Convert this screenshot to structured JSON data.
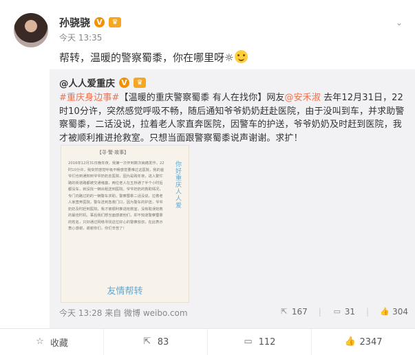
{
  "post": {
    "author": "孙骁骁",
    "verified_badge": "V",
    "member_badge": "♛",
    "time": "今天 13:35",
    "text": "帮转，温暖的警察蜀黍，你在哪里呀☼",
    "menu_icon": "chevron-down-icon"
  },
  "repost": {
    "author": "@人人爱重庆",
    "verified_badge": "V",
    "member_badge": "♛",
    "topic": "#重庆身边事#",
    "lead": "【温暖的重庆警察蜀黍 有人在找你】网友",
    "mention": "@安禾淑",
    "body": " 去年12月31日，22时10分许，突然感觉呼吸不畅，随后通知爷爷奶奶赶赴医院，由于没叫到车，并求助警察蜀黍，二话没说，拉着老人家直奔医院，因警车的护送，爷爷奶奶及时赶到医院，我才被顺利推进抢救室。只想当面跟警察蜀黍说声谢谢。求扩！",
    "image": {
      "title": "【寻·警·故事】",
      "side_text": "你好重庆人人爱",
      "body": "2016年12月31日晚年夜，我第一次怀到数次病痛发作，22时10分许，我突然感觉呼吸不畅感觉要难过这医院，我的爸爷们也到通知到爷爷奶奶去医院，因为是跨年夜，进入繁忙路的街道路都被交通堵塞，两位老人在五桥通了半个小时后都没车，就没找一辆出租送到医院。爷爷奶奶的救助情况，专门向路过的的一辆警车求助，警察蜀黍二话没说，拉着老人家直奔医院，警车送到急救门口，因为警车的护送，爷爷奶奶及时赶到医院，我才被顺利推进抢救室，没有耽误抢救的最佳时机。事后我们想当面感谢他们，却不知道警察蜀黍的姓名，只好通过网络寻找这位好心的警察叔叔，在此表示衷心感谢，谢谢你们，你们辛苦了！",
      "footer": "友情帮转"
    },
    "time": "今天 13:28 来自 微博 weibo.com",
    "reposts": "167",
    "comments": "31",
    "likes": "304"
  },
  "actions": [
    {
      "icon": "star-icon",
      "label": "收藏"
    },
    {
      "icon": "share-icon",
      "label": "83"
    },
    {
      "icon": "comment-icon",
      "label": "112"
    },
    {
      "icon": "thumbs-up-icon",
      "label": "2347"
    }
  ],
  "colors": {
    "link": "#eb7350",
    "accent": "#f29100",
    "repost_bg": "#f2f2f5"
  }
}
